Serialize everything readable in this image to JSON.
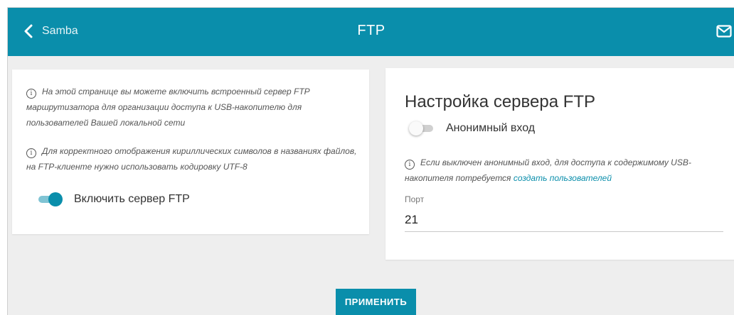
{
  "header": {
    "back_label": "Samba",
    "title": "FTP",
    "accent_color": "#0a8eab",
    "back_icon": "chevron-left-icon",
    "mail_icon": "mail-icon"
  },
  "left_panel": {
    "info1": "На этой странице вы можете включить встроенный сервер FTP маршрутизатора для организации доступа к USB-накопителю для пользователей Вашей локальной сети",
    "info2": "Для корректного отображения кириллических символов в названиях файлов, на FTP-клиенте нужно использовать кодировку UTF-8",
    "enable_ftp_label": "Включить сервер FTP",
    "enable_ftp_on": true
  },
  "right_panel": {
    "title": "Настройка сервера FTP",
    "anonymous_label": "Анонимный вход",
    "anonymous_on": false,
    "info_text": "Если выключен анонимный вход, для доступа к содержимому USB-накопителя потребуется",
    "info_link": "создать пользователей",
    "port_label": "Порт",
    "port_value": "21"
  },
  "actions": {
    "apply_label": "ПРИМЕНИТЬ"
  }
}
